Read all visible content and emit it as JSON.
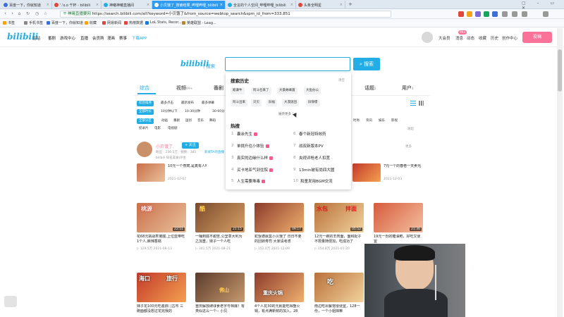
{
  "browser": {
    "tabs": [
      {
        "label": "百度一下，你就知道",
        "color": "#3c6fd6"
      },
      {
        "label": "神曦神曦直播间",
        "color": "#23ade5"
      },
      {
        "label": "小贝饿了_搜索结果_哔哩哔哩_bilibili",
        "color": "#23ade5"
      },
      {
        "label": "全言的个人空间_哔哩哔哩_bilibili",
        "color": "#23ade5"
      },
      {
        "label": "头条全明星",
        "color": "#e0463c"
      }
    ],
    "tab_second_left": "'.'o.o 千杯 - bilibili",
    "address_prefix": "神曦直播要网",
    "address_url": "https://search.bilibili.com/all?keyword=小贝饿了&from_source=webtop_search&spm_id_from=333.851",
    "bookmarks": [
      "书签",
      "手机书签",
      "百度一下，你就知道",
      "收藏",
      "网易新闻",
      "热榜数据",
      "LoL Stats, Recor...",
      "英雄联盟 - Leag..."
    ]
  },
  "header": {
    "logo": "bilibili",
    "nav": [
      "主站",
      "番剧",
      "游戏中心",
      "直播",
      "会员购",
      "漫画",
      "赛事",
      "下载APP"
    ],
    "right": [
      "大会员",
      "消息",
      "动态",
      "收藏",
      "历史",
      "创作中心"
    ],
    "badge": "99+",
    "upload": "投稿"
  },
  "search": {
    "logo": "bilibili",
    "logo_suffix": "| 搜索",
    "button": "搜索",
    "tabs": [
      {
        "label": "综合",
        "count": ""
      },
      {
        "label": "视频",
        "count": "99+"
      },
      {
        "label": "番剧",
        "count": ""
      },
      {
        "label": "话题",
        "count": "1"
      },
      {
        "label": "用户",
        "count": "1"
      }
    ],
    "sort": [
      "综合排序",
      "最多点击",
      "最新发布",
      "最多弹幕",
      "最多收藏"
    ],
    "duration": [
      "全部时长",
      "10分钟以下",
      "10-30分钟",
      "30-60分"
    ],
    "zones": [
      "全部分区",
      "动画",
      "番剧",
      "国创",
      "音乐",
      "舞蹈"
    ],
    "zones_right": [
      "时尚",
      "资讯",
      "娱乐",
      "影视"
    ],
    "zones2": [
      "纪录片",
      "电影",
      "电视剧"
    ],
    "collapse": "收起"
  },
  "dropdown": {
    "history_title": "搜索历史",
    "clear": "清空",
    "history": [
      "殿谦牛",
      "阿斗召来了",
      "大豪故峰菌",
      "大鱼办公",
      "阿斗出来",
      "贝贝",
      "旧福",
      "大漠饭团",
      "旧铮憬"
    ],
    "more": "展开更多",
    "hot_title": "热搜",
    "hot_left": [
      {
        "n": "1",
        "t": "囊余先生"
      },
      {
        "n": "2",
        "t": "单挑升往小体验"
      },
      {
        "n": "3",
        "t": "真实的边缘什么样"
      },
      {
        "n": "4",
        "t": "买卡地亚气到住院"
      },
      {
        "n": "5",
        "t": "人生需要堆毒"
      }
    ],
    "hot_right": [
      {
        "n": "6",
        "t": "春个新冠特效药"
      },
      {
        "n": "7",
        "t": "战双新版本PV"
      },
      {
        "n": "8",
        "t": "央视评枪老人扣宽"
      },
      {
        "n": "9",
        "t": "13min被有尚四大圆"
      },
      {
        "n": "10",
        "t": "和童发用BGM交流"
      }
    ]
  },
  "user": {
    "name": "小贝饿了",
    "follow": "+ 关注",
    "stats": "粉丝：230.5万 · 视频：385",
    "sub": "bilibili 知名美食UP主",
    "link": "新闻TA的直播",
    "more": "更多"
  },
  "videos": [
    {
      "title": "10元一个燕窝,是真有人吃",
      "meta": "2021-12-07",
      "dur": "25:01",
      "views": "",
      "date": "2021-12-07"
    },
    {
      "title": "7元一个的春卷一天卖光",
      "meta": "2021-12-03",
      "dur": "",
      "views": "",
      "date": "2021-12-03"
    },
    {
      "title": "花68元挑战乖离酸,上位蓝带吃1个人,麻辣香锅",
      "dur": "22:51",
      "views": "129.5万",
      "date": "2021-08-13"
    },
    {
      "title": "一桶到底不甜苦,公里意大利为之加重，妹子一个人吃",
      "dur": "21:15",
      "views": "341.5万",
      "date": "2021-08-21"
    },
    {
      "title": "蛇饭德晨盒小贝饿了 日日不要的回转寿司 大家请考虑",
      "dur": "09:17",
      "views": "152.0万",
      "date": "2021-12-09"
    },
    {
      "title": "12元一碗的羊肉面，面和配子不限量随便加，吃成功了",
      "dur": "05:52",
      "views": "254.8万",
      "date": "2021-01-20"
    },
    {
      "title": "19元一份的糖油粑，好吃又便宜",
      "dur": "21:36",
      "views": "",
      "date": ""
    },
    {
      "title": "妹子花100元吃遍旧门古市 三碗面都没想过花完我的",
      "dur": "",
      "views": "",
      "date": ""
    },
    {
      "title": "重庆解放碑球食老字号档爆！有类似这么一个-- 小贝",
      "dur": "",
      "views": "",
      "date": ""
    },
    {
      "title": "4个人花30的元就能吃得蟹火锅，有点满新鲜的加入，28",
      "dur": "",
      "views": "",
      "date": ""
    },
    {
      "title": "南边吃出餐馆很便宜，128一份，一个小姐妹嘛",
      "dur": "",
      "views": "",
      "date": ""
    }
  ],
  "thumb_text": [
    "桃源",
    "酷",
    "水包",
    "拌面",
    "海口",
    "旅行",
    "佛山",
    "重庆火锅",
    "吃"
  ],
  "colors": {
    "accent": "#23ade5",
    "pink": "#fb7299"
  }
}
